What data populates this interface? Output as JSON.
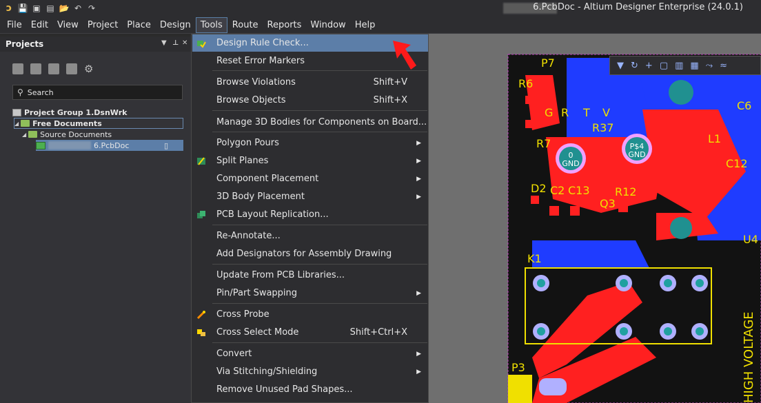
{
  "window": {
    "title": "6.PcbDoc - Altium Designer Enterprise (24.0.1)"
  },
  "menubar": {
    "items": [
      "File",
      "Edit",
      "View",
      "Project",
      "Place",
      "Design",
      "Tools",
      "Route",
      "Reports",
      "Window",
      "Help"
    ],
    "active": "Tools"
  },
  "projects_panel": {
    "title": "Projects",
    "search_placeholder": "Search",
    "tree": {
      "group": "Project Group 1.DsnWrk",
      "free_docs": "Free Documents",
      "source_docs": "Source Documents",
      "file": "6.PcbDoc"
    }
  },
  "tools_menu": {
    "items": [
      {
        "label": "Design Rule Check...",
        "shortcut": "",
        "submenu": false,
        "icon": "drc-icon",
        "selected": true
      },
      {
        "label": "Reset Error Markers",
        "shortcut": "",
        "submenu": false
      },
      {
        "label": "Browse Violations",
        "shortcut": "Shift+V",
        "submenu": false
      },
      {
        "label": "Browse Objects",
        "shortcut": "Shift+X",
        "submenu": false
      },
      {
        "label": "Manage 3D Bodies for Components on Board...",
        "shortcut": "",
        "submenu": false
      },
      {
        "label": "Polygon Pours",
        "shortcut": "",
        "submenu": true
      },
      {
        "label": "Split Planes",
        "shortcut": "",
        "submenu": true,
        "icon": "split-planes-icon"
      },
      {
        "label": "Component Placement",
        "shortcut": "",
        "submenu": true
      },
      {
        "label": "3D Body Placement",
        "shortcut": "",
        "submenu": true
      },
      {
        "label": "PCB Layout Replication...",
        "shortcut": "",
        "submenu": false,
        "icon": "replication-icon"
      },
      {
        "label": "Re-Annotate...",
        "shortcut": "",
        "submenu": false
      },
      {
        "label": "Add Designators for Assembly Drawing",
        "shortcut": "",
        "submenu": false
      },
      {
        "label": "Update From PCB Libraries...",
        "shortcut": "",
        "submenu": false
      },
      {
        "label": "Pin/Part Swapping",
        "shortcut": "",
        "submenu": true
      },
      {
        "label": "Cross Probe",
        "shortcut": "",
        "submenu": false,
        "icon": "cross-probe-icon"
      },
      {
        "label": "Cross Select Mode",
        "shortcut": "Shift+Ctrl+X",
        "submenu": false,
        "icon": "cross-select-icon"
      },
      {
        "label": "Convert",
        "shortcut": "",
        "submenu": true
      },
      {
        "label": "Via Stitching/Shielding",
        "shortcut": "",
        "submenu": true
      },
      {
        "label": "Remove Unused Pad Shapes...",
        "shortcut": "",
        "submenu": false
      }
    ]
  },
  "canvas_labels": {
    "silk": [
      "P7",
      "R6",
      "G",
      "R",
      "T",
      "V",
      "R37",
      "R7",
      "C2",
      "C13",
      "R12",
      "D2",
      "Q3",
      "K1",
      "L1",
      "C12",
      "C6",
      "U4",
      "P3",
      "HIGH VOLTAGE"
    ],
    "pads": [
      "0 GND",
      "P$4 GND"
    ]
  }
}
